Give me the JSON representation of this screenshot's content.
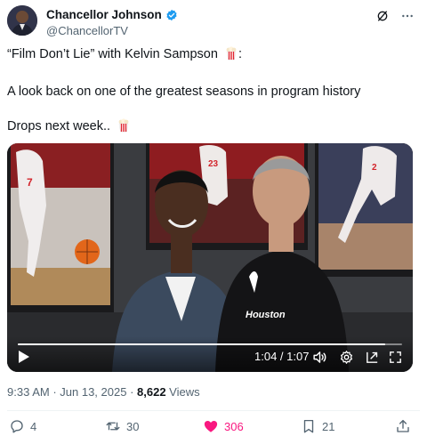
{
  "author": {
    "name": "Chancellor Johnson",
    "handle": "@ChancellorTV",
    "verified": true
  },
  "tweet": {
    "line1": "“Film Don’t Lie” with Kelvin Sampson",
    "line1_suffix": ":",
    "line2": "A look back on one of the greatest seasons in program history",
    "line3": "Drops next week.."
  },
  "video": {
    "elapsed": "1:04",
    "duration": "1:07",
    "time_display": "1:04 / 1:07",
    "progress": 0.955,
    "jersey_numbers": [
      "7",
      "23",
      "2"
    ],
    "shirt_text": "Houston"
  },
  "meta": {
    "time": "9:33 AM",
    "date": "Jun 13, 2025",
    "separator": " · ",
    "views_count": "8,622",
    "views_label": " Views"
  },
  "actions": {
    "replies": "4",
    "reposts": "30",
    "likes": "306",
    "bookmarks": "21"
  },
  "colors": {
    "accent_blue": "#1d9bf0",
    "like_pink": "#f91880",
    "secondary_text": "#536471"
  }
}
